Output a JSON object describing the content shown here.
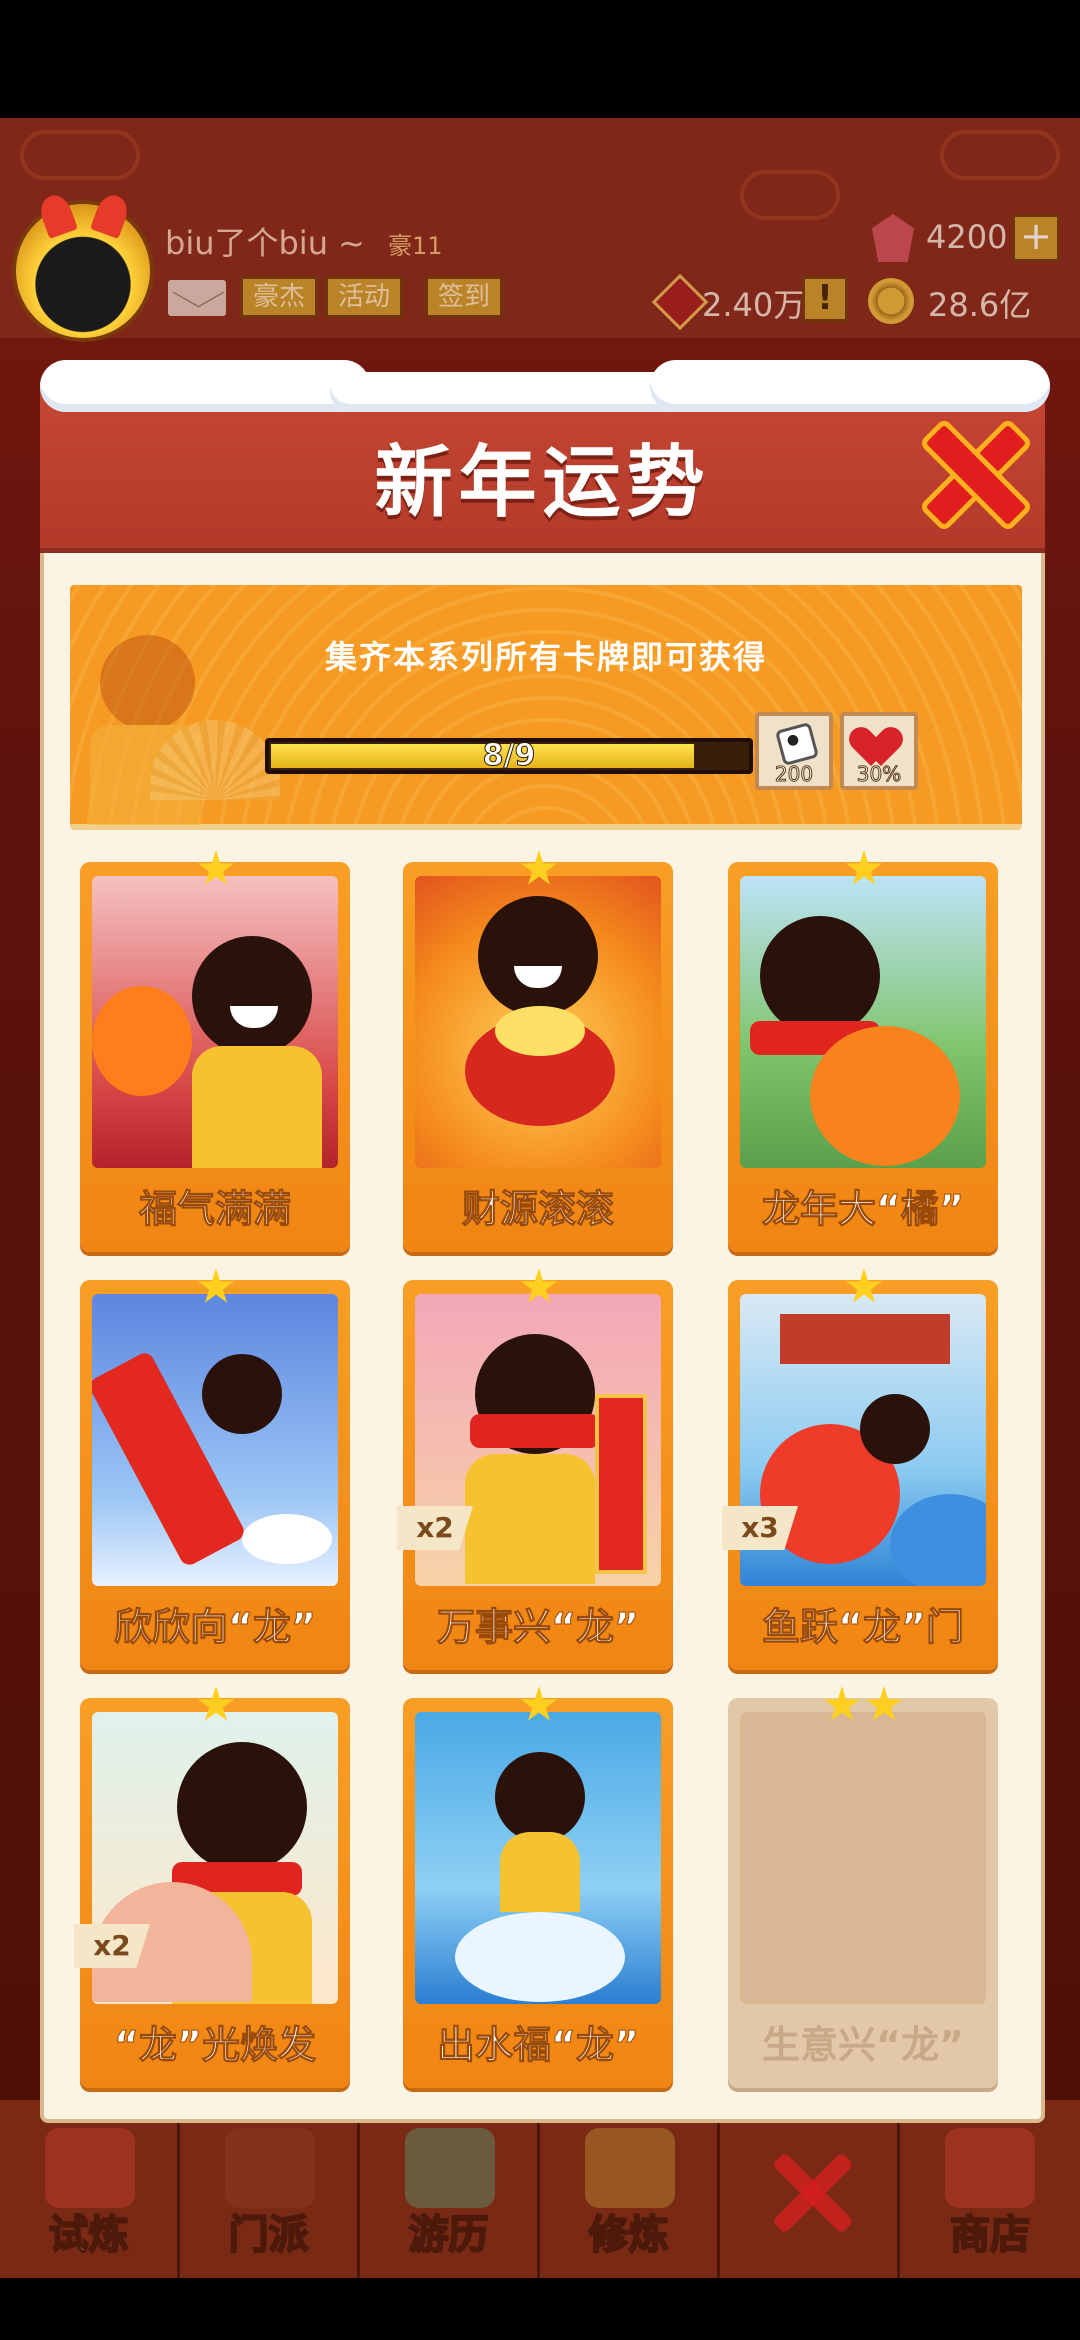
{
  "player": {
    "name": "biu了个biu ~",
    "vip": "豪11"
  },
  "header_tags": [
    "豪杰",
    "活动",
    "签到"
  ],
  "resources": {
    "gems": "4200",
    "power": "2.40万",
    "coins": "28.6亿"
  },
  "modal": {
    "title": "新年运势",
    "banner_text": "集齐本系列所有卡牌即可获得",
    "progress": {
      "label": "8/9",
      "value": 8,
      "max": 9
    },
    "rewards": [
      {
        "icon": "dice-icon",
        "count": "200"
      },
      {
        "icon": "heart-icon",
        "count": "30%"
      }
    ]
  },
  "cards": [
    {
      "name": "福气满满",
      "stars": 1,
      "badge": ""
    },
    {
      "name": "财源滚滚",
      "stars": 1,
      "badge": ""
    },
    {
      "name": "龙年大“橘”",
      "stars": 1,
      "badge": ""
    },
    {
      "name": "欣欣向“龙”",
      "stars": 1,
      "badge": ""
    },
    {
      "name": "万事兴“龙”",
      "stars": 1,
      "badge": "x2"
    },
    {
      "name": "鱼跃“龙”门",
      "stars": 1,
      "badge": "x3"
    },
    {
      "name": "“龙”光焕发",
      "stars": 1,
      "badge": "x2"
    },
    {
      "name": "出水福“龙”",
      "stars": 1,
      "badge": ""
    },
    {
      "name": "生意兴“龙”",
      "stars": 2,
      "badge": "",
      "locked": true
    }
  ],
  "bottom_nav": [
    "试炼",
    "门派",
    "游历",
    "修炼",
    "商店"
  ],
  "colors": {
    "accent": "#f08513",
    "title_bar": "#b33a2a",
    "close": "#e21d1d"
  }
}
